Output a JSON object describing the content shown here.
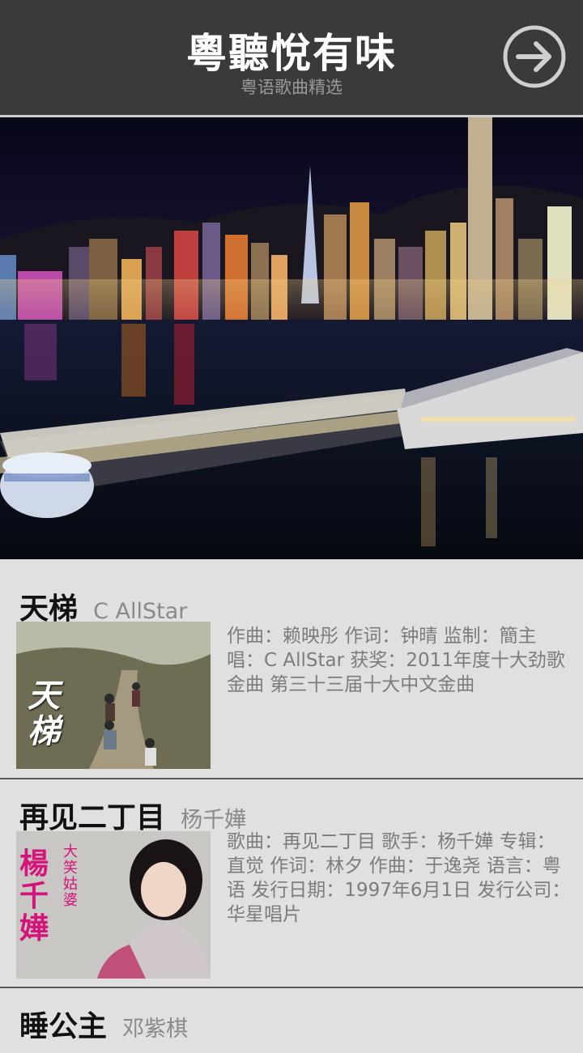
{
  "header": {
    "title": "粵聽悅有味",
    "subtitle": "粤语歌曲精选",
    "next_icon": "arrow-right-circle-icon"
  },
  "banner": {
    "image": "hong-kong-harbour-night-skyline"
  },
  "songs": [
    {
      "title": "天梯",
      "artist": "C AllStar",
      "thumb_text": "天梯",
      "description": "作曲：赖映彤  作词：钟晴  监制：簡主唱：C AllStar 获奖：2011年度十大劲歌金曲  第三十三届十大中文金曲"
    },
    {
      "title": "再见二丁目",
      "artist": "杨千嬅",
      "thumb_text": "楊千嬅",
      "thumb_subtext": "大笑姑婆",
      "description": "歌曲：再见二丁目  歌手：杨千嬅  专辑：直觉  作词：林夕  作曲：于逸尧  语言：粤语  发行日期：1997年6月1日  发行公司：华星唱片"
    },
    {
      "title": "睡公主",
      "artist": "邓紫棋"
    }
  ],
  "colors": {
    "header_bg": "#3a3a3a",
    "list_bg": "#e0e0e0",
    "title_text": "#111111",
    "meta_text": "#7c7c7c",
    "thumb2_accent": "#d4147a"
  }
}
